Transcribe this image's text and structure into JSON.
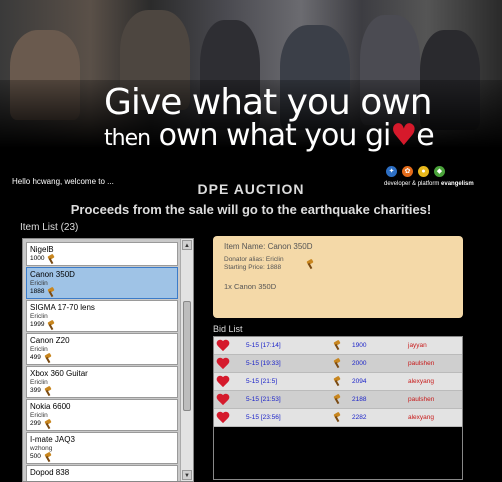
{
  "banner": {
    "tagline_line1": "Give what you own",
    "tagline_then": "then",
    "tagline_line2_main": "own what you gi",
    "tagline_line2_heart": "♥",
    "tagline_line2_end": "e"
  },
  "welcome": "Hello hcwang, welcome to ...",
  "dpe": {
    "prefix": "developer & platform",
    "bold": "evangelism",
    "dot_colors": [
      "#2d6fc4",
      "#e36b1a",
      "#e8b81c",
      "#4aa33a"
    ]
  },
  "title": "DPE AUCTION",
  "subtitle": "Proceeds from the sale will go to the earthquake charities!",
  "item_list": {
    "label": "Item List (23)",
    "items": [
      {
        "name": "NigelB",
        "alias": "",
        "price": "1000"
      },
      {
        "name": "Canon 350D",
        "alias": "Ericlin",
        "price": "1888"
      },
      {
        "name": "SIGMA 17-70 lens",
        "alias": "Ericlin",
        "price": "1999"
      },
      {
        "name": "Canon Z20",
        "alias": "Ericlin",
        "price": "499"
      },
      {
        "name": "Xbox 360 Guitar",
        "alias": "Ericlin",
        "price": "399"
      },
      {
        "name": "Nokia 6600",
        "alias": "Ericlin",
        "price": "299"
      },
      {
        "name": "I-mate JAQ3",
        "alias": "wzhong",
        "price": "500"
      },
      {
        "name": "Dopod 838",
        "alias": "",
        "price": ""
      }
    ],
    "selected_index": 1
  },
  "detail": {
    "item_name": "Item Name: Canon 350D",
    "donator": "Donator alias: Ericlin",
    "starting_price": "Starting Price: 1888",
    "quantity": "1x Canon 350D"
  },
  "bid_list": {
    "label": "Bid List",
    "bids": [
      {
        "time": "5-15 [17:14]",
        "amount": "1900",
        "user": "jayyan"
      },
      {
        "time": "5-15 [19:33]",
        "amount": "2000",
        "user": "paulshen"
      },
      {
        "time": "5-15 [21:5]",
        "amount": "2094",
        "user": "alexyang"
      },
      {
        "time": "5-15 [21:53]",
        "amount": "2188",
        "user": "paulshen"
      },
      {
        "time": "5-15 [23:56]",
        "amount": "2282",
        "user": "alexyang"
      }
    ]
  },
  "colors": {
    "accent_heart": "#d51a2c",
    "selected_item": "#9fc3e6",
    "detail_panel": "#f4d9a8",
    "bid_time": "#1a22c8",
    "bid_user": "#c81a1a"
  }
}
